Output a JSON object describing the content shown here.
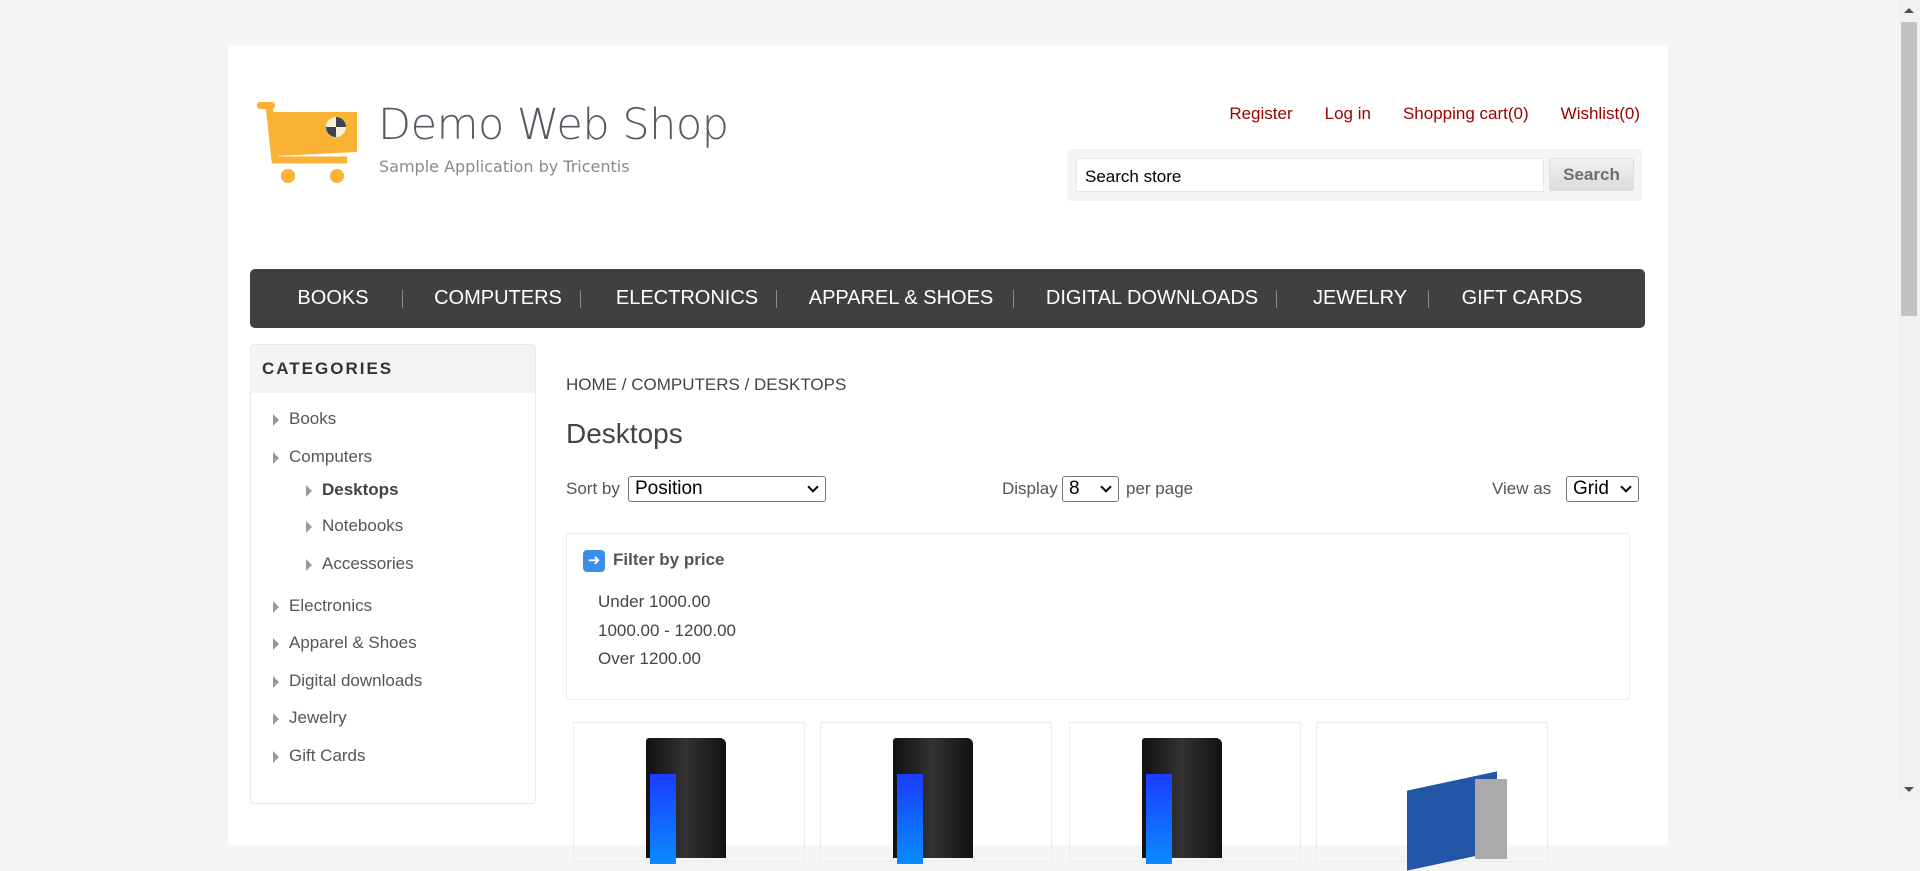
{
  "header": {
    "brand": "Demo Web Shop",
    "tagline": "Sample Application by Tricentis",
    "links": [
      "Register",
      "Log in",
      "Shopping cart(0)",
      "Wishlist(0)"
    ],
    "search_placeholder": "Search store",
    "search_button": "Search"
  },
  "nav": [
    "BOOKS",
    "COMPUTERS",
    "ELECTRONICS",
    "APPAREL & SHOES",
    "DIGITAL DOWNLOADS",
    "JEWELRY",
    "GIFT CARDS"
  ],
  "sidebar": {
    "title": "CATEGORIES",
    "items": [
      "Books",
      "Computers",
      "Desktops",
      "Notebooks",
      "Accessories",
      "Electronics",
      "Apparel & Shoes",
      "Digital downloads",
      "Jewelry",
      "Gift Cards"
    ],
    "active": "Desktops"
  },
  "breadcrumb": {
    "home": "HOME",
    "sep": "/",
    "computers": "COMPUTERS",
    "current": "DESKTOPS"
  },
  "main": {
    "title": "Desktops",
    "sort_label": "Sort by",
    "sort_value": "Position",
    "display_label": "Display",
    "display_value": "8",
    "per_page": "per page",
    "view_label": "View as",
    "view_value": "Grid"
  },
  "filter": {
    "title": "Filter by price",
    "options": [
      "Under 1000.00",
      "1000.00 - 1200.00",
      "Over 1200.00"
    ]
  },
  "colors": {
    "link": "#990000",
    "nav_bg": "#404040",
    "logo": "#f9b234"
  }
}
